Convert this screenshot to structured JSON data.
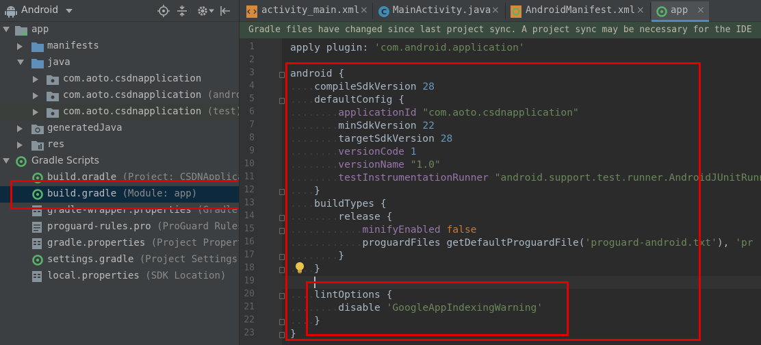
{
  "project_panel": {
    "view_label": "Android",
    "tree": [
      {
        "label": "app",
        "hint": ""
      },
      {
        "label": "manifests",
        "hint": ""
      },
      {
        "label": "java",
        "hint": ""
      },
      {
        "label": "com.aoto.csdnapplication",
        "hint": ""
      },
      {
        "label": "com.aoto.csdnapplication",
        "hint": "(androi"
      },
      {
        "label": "com.aoto.csdnapplication",
        "hint": "(test)"
      },
      {
        "label": "generatedJava",
        "hint": ""
      },
      {
        "label": "res",
        "hint": ""
      },
      {
        "label": "Gradle Scripts",
        "hint": ""
      },
      {
        "label": "build.gradle",
        "hint": "(Project: CSDNApplicat"
      },
      {
        "label": "build.gradle",
        "hint": "(Module: app)"
      },
      {
        "label": "gradle-wrapper.properties",
        "hint": "(Gradle V"
      },
      {
        "label": "proguard-rules.pro",
        "hint": "(ProGuard Rules"
      },
      {
        "label": "gradle.properties",
        "hint": "(Project Properti"
      },
      {
        "label": "settings.gradle",
        "hint": "(Project Settings)"
      },
      {
        "label": "local.properties",
        "hint": "(SDK Location)"
      }
    ]
  },
  "editor": {
    "tabs": [
      {
        "label": "activity_main.xml",
        "icon": "xml-layout-icon",
        "active": false
      },
      {
        "label": "MainActivity.java",
        "icon": "java-class-icon",
        "active": false
      },
      {
        "label": "AndroidManifest.xml",
        "icon": "manifest-icon",
        "active": false
      },
      {
        "label": "app",
        "icon": "gradle-icon",
        "active": true
      }
    ],
    "close_glyph": "×",
    "notification": "Gradle files have changed since last project sync. A project sync may be necessary for the IDE",
    "line_numbers": [
      "1",
      "2",
      "3",
      "4",
      "5",
      "6",
      "7",
      "8",
      "9",
      "10",
      "11",
      "12",
      "13",
      "14",
      "15",
      "16",
      "17",
      "18",
      "19",
      "20",
      "21",
      "22",
      "23"
    ],
    "code": {
      "l1": {
        "kw": "apply",
        "key": "plugin",
        "colon": ":",
        "str": "'com.android.application'"
      },
      "l3": {
        "id": "android",
        "brace": "{"
      },
      "l4": {
        "id": "compileSdkVersion",
        "num": "28"
      },
      "l5": {
        "id": "defaultConfig",
        "brace": "{"
      },
      "l6": {
        "prop": "applicationId",
        "str": "\"com.aoto.csdnapplication\""
      },
      "l7": {
        "id": "minSdkVersion",
        "num": "22"
      },
      "l8": {
        "id": "targetSdkVersion",
        "num": "28"
      },
      "l9": {
        "prop": "versionCode",
        "num": "1"
      },
      "l10": {
        "prop": "versionName",
        "str": "\"1.0\""
      },
      "l11": {
        "prop": "testInstrumentationRunner",
        "str": "\"android.support.test.runner.AndroidJUnitRunner\""
      },
      "l12": {
        "brace": "}"
      },
      "l13": {
        "id": "buildTypes",
        "brace": "{"
      },
      "l14": {
        "id": "release",
        "brace": "{"
      },
      "l15": {
        "prop": "minifyEnabled",
        "kw": "false"
      },
      "l16": {
        "id": "proguardFiles",
        "fn": "getDefaultProguardFile",
        "open": "(",
        "str": "'proguard-android.txt'",
        "close": "),",
        "str2": "'pr"
      },
      "l17": {
        "brace": "}"
      },
      "l18": {
        "brace": "}"
      },
      "l20": {
        "id": "lintOptions",
        "brace": "{"
      },
      "l21": {
        "id": "disable",
        "str": "'GoogleAppIndexingWarning'"
      },
      "l22": {
        "brace": "}"
      },
      "l23": {
        "brace": "}"
      }
    }
  },
  "colors": {
    "highlight_box": "#e50000",
    "keyword": "#cc7832",
    "string": "#6a8759",
    "number": "#6897bb",
    "property": "#9876aa"
  }
}
